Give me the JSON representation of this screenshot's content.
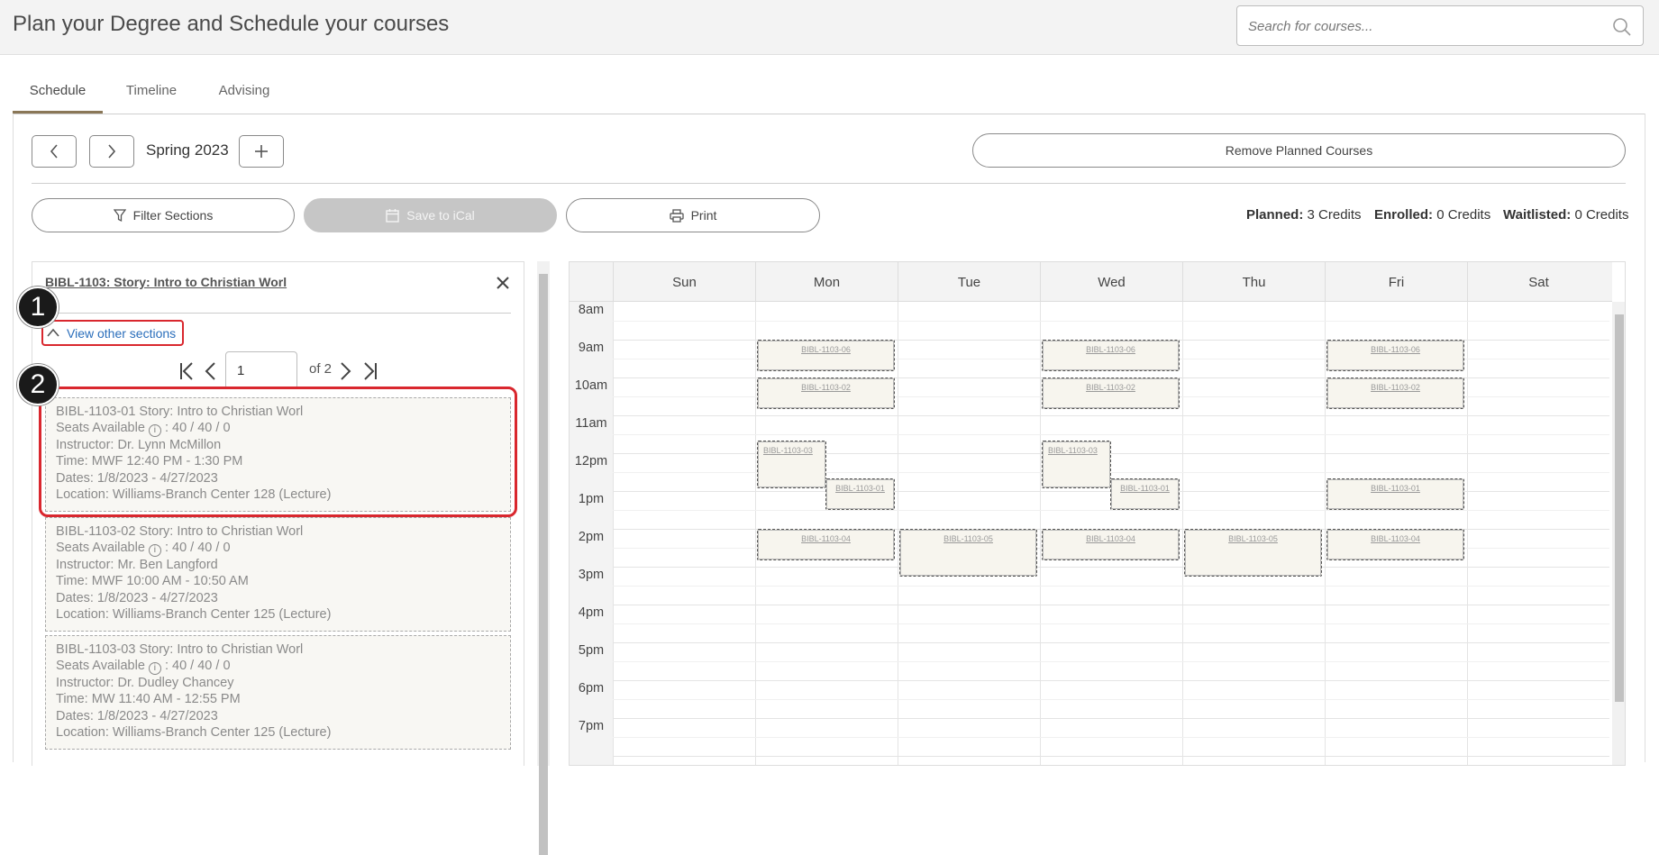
{
  "header": {
    "title": "Plan your Degree and Schedule your courses",
    "search_placeholder": "Search for courses..."
  },
  "tabs": [
    {
      "label": "Schedule",
      "active": true
    },
    {
      "label": "Timeline",
      "active": false
    },
    {
      "label": "Advising",
      "active": false
    }
  ],
  "toolbar": {
    "term": "Spring 2023",
    "remove_label": "Remove Planned Courses",
    "filter_label": "Filter Sections",
    "ical_label": "Save to iCal",
    "print_label": "Print"
  },
  "credits": {
    "planned_label": "Planned:",
    "planned_value": "3 Credits",
    "enrolled_label": "Enrolled:",
    "enrolled_value": "0 Credits",
    "waitlisted_label": "Waitlisted:",
    "waitlisted_value": "0 Credits"
  },
  "panel": {
    "course_title": "BIBL-1103: Story: Intro to Christian Worl",
    "view_other": "View other sections",
    "page_value": "1",
    "of_pages": "of 2",
    "callout_1": "1",
    "callout_2": "2"
  },
  "sections": [
    {
      "title": "BIBL-1103-01 Story: Intro to Christian Worl",
      "seats_label": "Seats Available",
      "seats_value": ": 40 / 40 / 0",
      "instructor": "Instructor: Dr. Lynn McMillon",
      "time": "Time: MWF 12:40 PM - 1:30 PM",
      "dates": "Dates: 1/8/2023 - 4/27/2023",
      "location": "Location: Williams-Branch Center 128 (Lecture)"
    },
    {
      "title": "BIBL-1103-02 Story: Intro to Christian Worl",
      "seats_label": "Seats Available",
      "seats_value": ": 40 / 40 / 0",
      "instructor": "Instructor: Mr. Ben Langford",
      "time": "Time: MWF 10:00 AM - 10:50 AM",
      "dates": "Dates: 1/8/2023 - 4/27/2023",
      "location": "Location: Williams-Branch Center 125 (Lecture)"
    },
    {
      "title": "BIBL-1103-03 Story: Intro to Christian Worl",
      "seats_label": "Seats Available",
      "seats_value": ": 40 / 40 / 0",
      "instructor": "Instructor: Dr. Dudley Chancey",
      "time": "Time: MW 11:40 AM - 12:55 PM",
      "dates": "Dates: 1/8/2023 - 4/27/2023",
      "location": "Location: Williams-Branch Center 125 (Lecture)"
    }
  ],
  "calendar": {
    "days": [
      "Sun",
      "Mon",
      "Tue",
      "Wed",
      "Thu",
      "Fri",
      "Sat"
    ],
    "hours": [
      "8am",
      "9am",
      "10am",
      "11am",
      "12pm",
      "1pm",
      "2pm",
      "3pm",
      "4pm",
      "5pm",
      "6pm",
      "7pm"
    ],
    "events": [
      {
        "label": "BIBL-1103-06",
        "day": "Mon",
        "start": 9.0,
        "end": 9.83
      },
      {
        "label": "BIBL-1103-06",
        "day": "Wed",
        "start": 9.0,
        "end": 9.83
      },
      {
        "label": "BIBL-1103-06",
        "day": "Fri",
        "start": 9.0,
        "end": 9.83
      },
      {
        "label": "BIBL-1103-02",
        "day": "Mon",
        "start": 10.0,
        "end": 10.83
      },
      {
        "label": "BIBL-1103-02",
        "day": "Wed",
        "start": 10.0,
        "end": 10.83
      },
      {
        "label": "BIBL-1103-02",
        "day": "Fri",
        "start": 10.0,
        "end": 10.83
      },
      {
        "label": "BIBL-1103-03",
        "day": "Mon",
        "start": 11.67,
        "end": 12.92,
        "half": "left"
      },
      {
        "label": "BIBL-1103-03",
        "day": "Wed",
        "start": 11.67,
        "end": 12.92,
        "half": "left"
      },
      {
        "label": "BIBL-1103-01",
        "day": "Mon",
        "start": 12.67,
        "end": 13.5,
        "half": "right"
      },
      {
        "label": "BIBL-1103-01",
        "day": "Wed",
        "start": 12.67,
        "end": 13.5,
        "half": "right"
      },
      {
        "label": "BIBL-1103-01",
        "day": "Fri",
        "start": 12.67,
        "end": 13.5
      },
      {
        "label": "BIBL-1103-04",
        "day": "Mon",
        "start": 14.0,
        "end": 14.83
      },
      {
        "label": "BIBL-1103-04",
        "day": "Wed",
        "start": 14.0,
        "end": 14.83
      },
      {
        "label": "BIBL-1103-04",
        "day": "Fri",
        "start": 14.0,
        "end": 14.83
      },
      {
        "label": "BIBL-1103-05",
        "day": "Tue",
        "start": 14.0,
        "end": 15.25
      },
      {
        "label": "BIBL-1103-05",
        "day": "Thu",
        "start": 14.0,
        "end": 15.25
      }
    ]
  }
}
